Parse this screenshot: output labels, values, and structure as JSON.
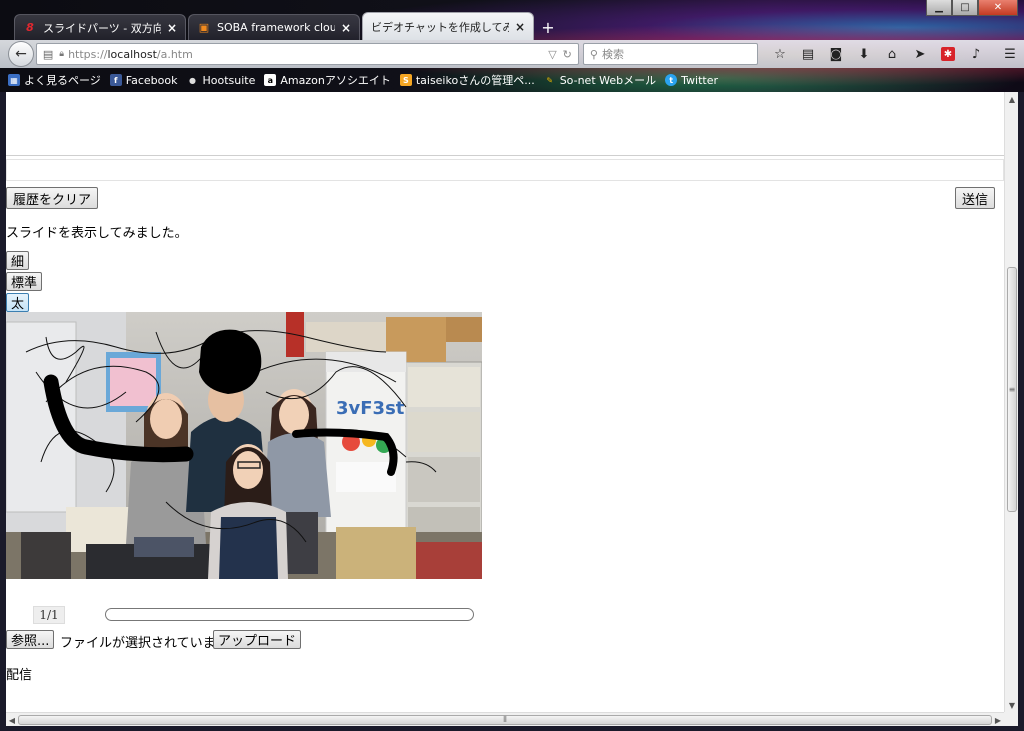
{
  "window": {
    "minimize": "▁",
    "maximize": "□",
    "close": "✕"
  },
  "tabs": [
    {
      "icon": "8",
      "title": "スライドパーツ - 双方向...",
      "close": "×"
    },
    {
      "icon": "▣",
      "title": "SOBA framework cloud",
      "close": "×"
    },
    {
      "icon": "",
      "title": "ビデオチャットを作成してみた",
      "close": "×"
    }
  ],
  "new_tab": "+",
  "nav": {
    "url_scheme": "https://",
    "url_host": "localhost",
    "url_path": "/a.htm",
    "search_placeholder": "検索"
  },
  "bookmarks": [
    {
      "label": "よく見るページ",
      "icon_color": "#3b6fc4"
    },
    {
      "label": "Facebook",
      "icon_color": "#3b5998"
    },
    {
      "label": "Hootsuite",
      "icon_color": "#444444"
    },
    {
      "label": "Amazonアソシエイト",
      "icon_color": "#ffffff"
    },
    {
      "label": "taiseikoさんの管理ペ...",
      "icon_color": "#f5a623"
    },
    {
      "label": "So-net Webメール",
      "icon_color": "#e8b400"
    },
    {
      "label": "Twitter",
      "icon_color": "#2aa3ef"
    }
  ],
  "page": {
    "clear_history_button": "履歴をクリア",
    "send_button": "送信",
    "status_message": "スライドを表示してみました。",
    "pen_thin": "細",
    "pen_normal": "標準",
    "pen_thick": "太",
    "page_counter": "1/1",
    "progress": 0,
    "browse_button": "参照...",
    "no_file_text": "ファイルが選択されていません。",
    "upload_button": "アップロード",
    "broadcast_label": "配信"
  }
}
